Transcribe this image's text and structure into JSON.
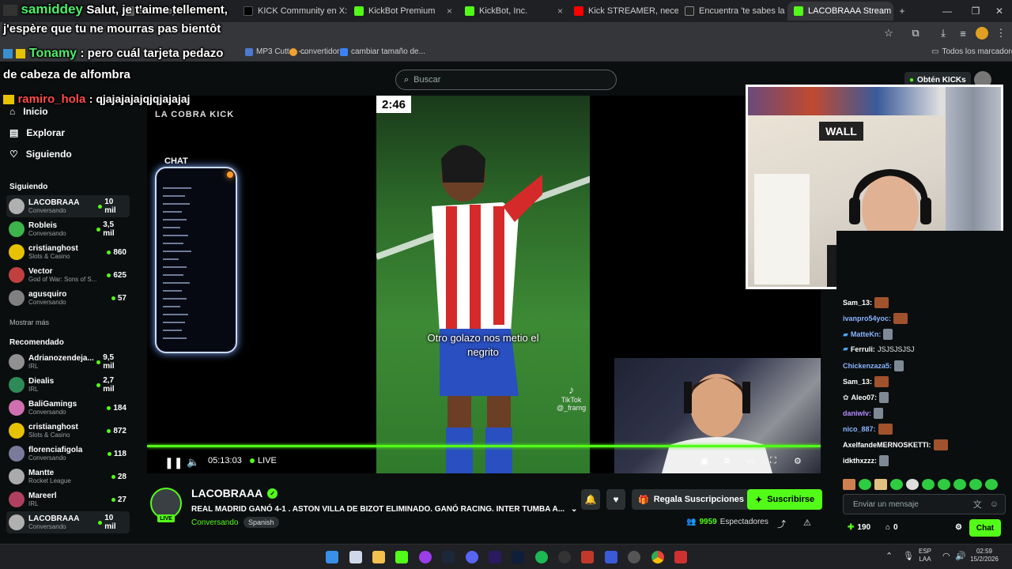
{
  "browser": {
    "tabs": [
      {
        "label": "samiddey",
        "fav": "#6a6a6a"
      },
      {
        "label": "KICK Community en X: \"si",
        "fav": "#000000"
      },
      {
        "label": "KickBot Premium",
        "fav": "#53fc18"
      },
      {
        "label": "KickBot, Inc.",
        "fav": "#53fc18"
      },
      {
        "label": "Kick STREAMER, necesitas",
        "fav": "#ff0000"
      },
      {
        "label": "Encuentra 'te sabes la nu",
        "fav": "#222222"
      },
      {
        "label": "LACOBRAAA Stream",
        "fav": "#53fc18"
      }
    ],
    "bookmarks": [
      {
        "label": "MP3 Cutter -...",
        "fav": "#4a7bd0"
      },
      {
        "label": "convertidor",
        "fav": "#f0a030"
      },
      {
        "label": "cambiar tamaño de...",
        "fav": "#3b82f6"
      }
    ],
    "all_bookmarks": "Todos los marcadores"
  },
  "overlay_chat": [
    {
      "user": "samiddey",
      "text": "Salut, je t'aime tellement,",
      "text2": "j'espère que tu ne mourras pas bientôt",
      "color": "#4ef06a"
    },
    {
      "user": "Tonamy",
      "text": ": pero cuál tarjeta pedazo",
      "text2": "de cabeza de alfombra",
      "color": "#4ef06a"
    },
    {
      "user": "ramiro_hola",
      "text": ": qjajajajajqjqjajajaj",
      "color": "#ff4a4a"
    }
  ],
  "search": {
    "placeholder": "Buscar"
  },
  "header": {
    "kicks": "Obtén KICKs"
  },
  "nav": {
    "home": "Inicio",
    "explore": "Explorar",
    "following": "Siguiendo"
  },
  "sidebar": {
    "following_title": "Siguiendo",
    "following": [
      {
        "name": "LACOBRAAA",
        "cat": "Conversando",
        "viewers": "10 mil",
        "color": "#b0b0b0"
      },
      {
        "name": "Robleis",
        "cat": "Conversando",
        "viewers": "3,5 mil",
        "color": "#3cb44b"
      },
      {
        "name": "cristianghost",
        "cat": "Slots & Casino",
        "viewers": "860",
        "color": "#e6c200"
      },
      {
        "name": "Vector",
        "cat": "God of War: Sons of S...",
        "viewers": "625",
        "color": "#c04040"
      },
      {
        "name": "agusquiro",
        "cat": "Conversando",
        "viewers": "57",
        "color": "#808080"
      }
    ],
    "show_more": "Mostrar más",
    "recommended_title": "Recomendado",
    "recommended": [
      {
        "name": "Adrianozendeja...",
        "cat": "IRL",
        "viewers": "9,5 mil",
        "color": "#909090"
      },
      {
        "name": "Diealis",
        "cat": "IRL",
        "viewers": "2,7 mil",
        "color": "#2e8b57"
      },
      {
        "name": "BaliGamings",
        "cat": "Conversando",
        "viewers": "184",
        "color": "#d070b0"
      },
      {
        "name": "cristianghost",
        "cat": "Slots & Casino",
        "viewers": "872",
        "color": "#e6c200"
      },
      {
        "name": "florenciafigola",
        "cat": "Conversando",
        "viewers": "118",
        "color": "#7a7a9a"
      },
      {
        "name": "Mantte",
        "cat": "Rocket League",
        "viewers": "28",
        "color": "#aaaaaa"
      },
      {
        "name": "Mareerl",
        "cat": "IRL",
        "viewers": "27",
        "color": "#b04060"
      },
      {
        "name": "LACOBRAAA",
        "cat": "Conversando",
        "viewers": "10 mil",
        "color": "#b0b0b0"
      }
    ]
  },
  "player": {
    "timer": "2:46",
    "watermark": "LA COBRA KICK",
    "overlay_chat_title": "CHAT",
    "subtitle": "Otro golazo nos metio el negrito",
    "tiktok": "TikTok",
    "tiktok_handle": "@_framg",
    "time": "05:13:03",
    "live": "LIVE",
    "wall_sign": "WALL"
  },
  "stream": {
    "channel": "LACOBRAAA",
    "live_badge": "LIVE",
    "title": "REAL MADRID GANÓ 4-1 . ASTON VILLA DE BIZOT ELIMINADO. GANÓ RACING. INTER TUMBA A...",
    "category": "Conversando",
    "tag": "Spanish",
    "gift_label": "Regala Suscripciones",
    "subscribe_label": "Suscribirse",
    "viewers_count": "9959",
    "viewers_label": "Espectadores"
  },
  "chat": {
    "messages": [
      {
        "user": "Sam_13:",
        "color": "#ffffff",
        "text": "",
        "emote": "r"
      },
      {
        "user": "ivanpro54yoc:",
        "color": "#8ab4ff",
        "text": "",
        "emote": "r"
      },
      {
        "user": "MatteKn:",
        "color": "#8ab4ff",
        "text": "",
        "emote": "g"
      },
      {
        "user": "Ferruli:",
        "color": "#ffffff",
        "text": "JSJSJSJSJ",
        "emote": ""
      },
      {
        "user": "Chickenzaza5:",
        "color": "#8ab4ff",
        "text": "",
        "emote": "g"
      },
      {
        "user": "Sam_13:",
        "color": "#ffffff",
        "text": "",
        "emote": "r"
      },
      {
        "user": "Aleo07:",
        "color": "#ffffff",
        "text": "",
        "emote": "g"
      },
      {
        "user": "daniwlv:",
        "color": "#b48cff",
        "text": "",
        "emote": "g"
      },
      {
        "user": "nico_887:",
        "color": "#8ab4ff",
        "text": "",
        "emote": "r"
      },
      {
        "user": "AxelfandeMERNOSKETTI:",
        "color": "#ffffff",
        "text": "",
        "emote": "r"
      },
      {
        "user": "idkthxzzz:",
        "color": "#ffffff",
        "text": "",
        "emote": "g"
      }
    ],
    "input_placeholder": "Enviar un mensaje",
    "points": "190",
    "gifts": "0",
    "chat_button": "Chat"
  },
  "taskbar": {
    "lang": "ESP",
    "region": "LAA",
    "time": "02:59",
    "date": "15/2/2026"
  }
}
